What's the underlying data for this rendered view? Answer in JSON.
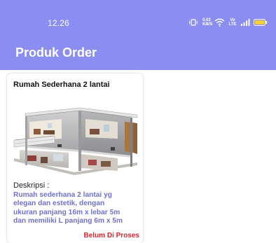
{
  "status_bar": {
    "time": "12.26",
    "icons": [
      "vibrate-icon",
      "data-speed-icon",
      "wifi-icon",
      "volte-icon",
      "signal-icon",
      "battery-icon"
    ],
    "data_speed_text": "0.02 KB/S",
    "volte_text": "Vo LTE"
  },
  "app_bar": {
    "title": "Produk Order"
  },
  "order_cards": [
    {
      "title": "Rumah Sederhana 2 lantai",
      "description_label": "Deskripsi :",
      "description": "Rumah sederhana 2 lantai  yg\nelegan dan estetik, dengan\nukuran panjang 16m x lebar 5m\ndan memiliki L panjang 6m x 5m",
      "status": "Belum Di Proses"
    }
  ],
  "colors": {
    "primary": "#8b8ef0",
    "description_text": "#6f72c9",
    "status_text": "#d8262b"
  }
}
